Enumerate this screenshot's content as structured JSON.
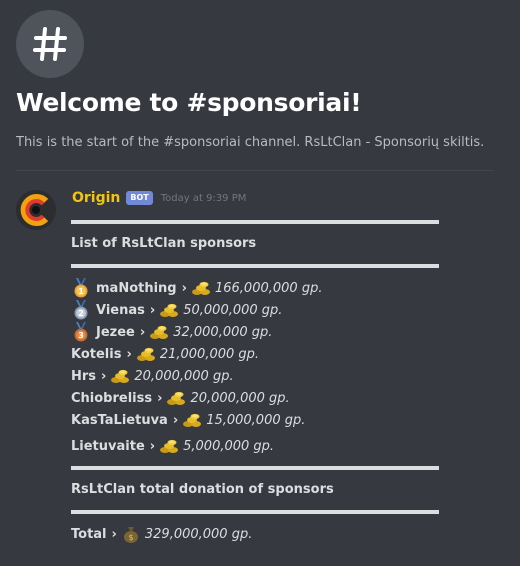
{
  "channel": {
    "icon": "hash-icon",
    "welcome_title": "Welcome to #sponsoriai!",
    "description": "This is the start of the #sponsoriai channel. RsLtClan - Sponsorių skiltis."
  },
  "message": {
    "author": "Origin",
    "bot_tag": "BOT",
    "timestamp": "Today at 9:39 PM",
    "author_color": "#f1c40f",
    "list_title": "List of RsLtClan sponsors",
    "arrow": "›",
    "sponsors": [
      {
        "name": "maNothing",
        "amount": "166,000,000 gp.",
        "medal": "gold-medal-icon"
      },
      {
        "name": "Vienas",
        "amount": "50,000,000 gp.",
        "medal": "silver-medal-icon"
      },
      {
        "name": "Jezee",
        "amount": "32,000,000 gp.",
        "medal": "bronze-medal-icon"
      },
      {
        "name": "Kotelis",
        "amount": "21,000,000 gp.",
        "medal": null
      },
      {
        "name": "Hrs",
        "amount": "20,000,000 gp.",
        "medal": null
      },
      {
        "name": "Chiobreliss",
        "amount": "20,000,000 gp.",
        "medal": null
      },
      {
        "name": "KasTaLietuva",
        "amount": "15,000,000 gp.",
        "medal": null
      },
      {
        "name": "Lietuvaite",
        "amount": "5,000,000 gp.",
        "medal": null
      }
    ],
    "total_title": "RsLtClan total donation of sponsors",
    "total_label": "Total",
    "total_amount": "329,000,000 gp.",
    "total_icon": "money-bag-icon",
    "coin_icon": "coins-icon"
  },
  "colors": {
    "background": "#36393f",
    "bot_tag": "#7289da",
    "rule": "#dcddde"
  }
}
